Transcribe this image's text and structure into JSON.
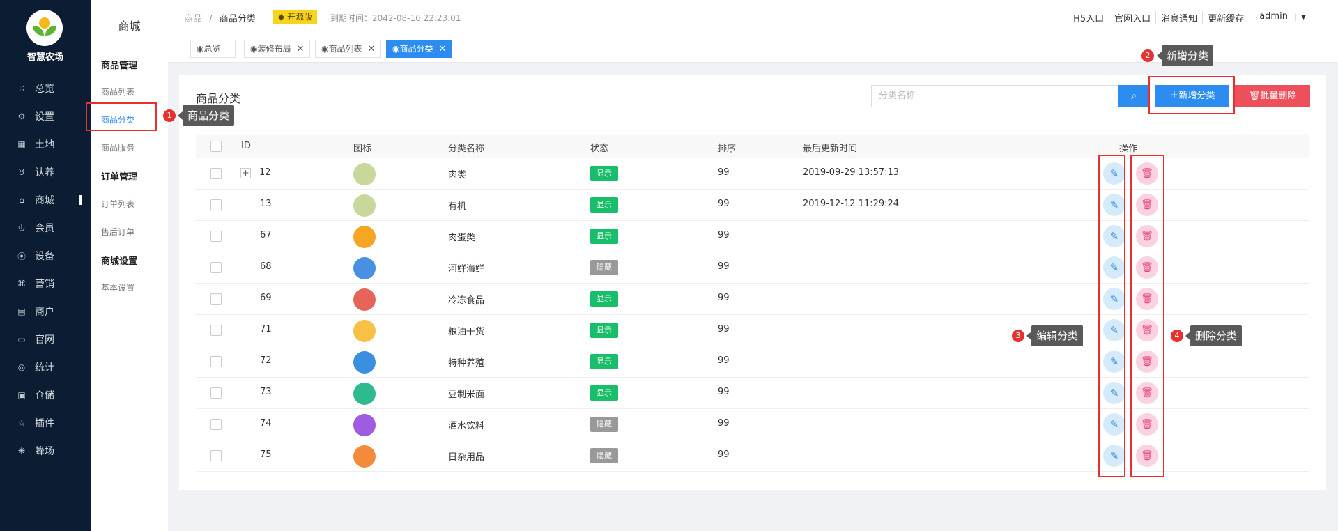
{
  "sidebar": {
    "brand": "智慧农场",
    "items": [
      {
        "icon": "grid-dots-icon",
        "glyph": "⁙",
        "label": "总览"
      },
      {
        "icon": "gear-icon",
        "glyph": "⚙",
        "label": "设置"
      },
      {
        "icon": "grid-icon",
        "glyph": "▦",
        "label": "土地"
      },
      {
        "icon": "bell-icon",
        "glyph": "♉",
        "label": "认养"
      },
      {
        "icon": "shop-icon",
        "glyph": "⌂",
        "label": "商城",
        "active": true
      },
      {
        "icon": "crown-icon",
        "glyph": "♔",
        "label": "会员"
      },
      {
        "icon": "pin-icon",
        "glyph": "⦿",
        "label": "设备"
      },
      {
        "icon": "share-icon",
        "glyph": "⌘",
        "label": "营销"
      },
      {
        "icon": "store-icon",
        "glyph": "▤",
        "label": "商户"
      },
      {
        "icon": "monitor-icon",
        "glyph": "▭",
        "label": "官网"
      },
      {
        "icon": "target-icon",
        "glyph": "◎",
        "label": "统计"
      },
      {
        "icon": "box-icon",
        "glyph": "▣",
        "label": "仓储"
      },
      {
        "icon": "star-icon",
        "glyph": "☆",
        "label": "插件"
      },
      {
        "icon": "bee-icon",
        "glyph": "❋",
        "label": "蜂场"
      }
    ]
  },
  "subnav": {
    "title": "商城",
    "group1": "商品管理",
    "item1": "商品列表",
    "item2": "商品分类",
    "item3": "商品服务",
    "group2": "订单管理",
    "item4": "订单列表",
    "item5": "售后订单",
    "group3": "商城设置",
    "item6": "基本设置"
  },
  "header": {
    "crumb1": "商品",
    "crumb_sep": "/",
    "crumb2": "商品分类",
    "badge": "开源版",
    "expire": "到期时间：2042-08-16 22:23:01",
    "links": [
      "H5入口",
      "官网入口",
      "消息通知",
      "更新缓存",
      "admin"
    ]
  },
  "tabs": [
    {
      "label": "◉总览"
    },
    {
      "label": "◉装修布局",
      "close": "✕"
    },
    {
      "label": "◉商品列表",
      "close": "✕"
    },
    {
      "label": "◉商品分类",
      "close": "✕",
      "active": true
    }
  ],
  "card": {
    "title": "商品分类",
    "search_placeholder": "分类名称",
    "add_label": "新增分类",
    "batch_delete_label": "批量删除"
  },
  "table": {
    "headers": {
      "id": "ID",
      "icon": "图标",
      "name": "分类名称",
      "status": "状态",
      "sort": "排序",
      "updated": "最后更新时间",
      "action": "操作"
    },
    "rows": [
      {
        "id": "12",
        "name": "肉类",
        "status": "显示",
        "sort": "99",
        "updated": "2019-09-29 13:57:13",
        "expand": "+",
        "color": "#c7d89a"
      },
      {
        "id": "13",
        "name": "有机",
        "status": "显示",
        "sort": "99",
        "updated": "2019-12-12 11:29:24",
        "color": "#c7d89a"
      },
      {
        "id": "67",
        "name": "肉蛋类",
        "status": "显示",
        "sort": "99",
        "updated": "",
        "color": "#f5a623"
      },
      {
        "id": "68",
        "name": "河鲜海鲜",
        "status": "隐藏",
        "sort": "99",
        "updated": "",
        "color": "#4a90e2"
      },
      {
        "id": "69",
        "name": "冷冻食品",
        "status": "显示",
        "sort": "99",
        "updated": "",
        "color": "#e8635a"
      },
      {
        "id": "71",
        "name": "粮油干货",
        "status": "显示",
        "sort": "99",
        "updated": "",
        "color": "#f8c146"
      },
      {
        "id": "72",
        "name": "特种养殖",
        "status": "显示",
        "sort": "99",
        "updated": "",
        "color": "#3a8fe0"
      },
      {
        "id": "73",
        "name": "豆制米面",
        "status": "显示",
        "sort": "99",
        "updated": "",
        "color": "#2fb98e"
      },
      {
        "id": "74",
        "name": "酒水饮料",
        "status": "隐藏",
        "sort": "99",
        "updated": "",
        "color": "#a05ce0"
      },
      {
        "id": "75",
        "name": "日杂用品",
        "status": "隐藏",
        "sort": "99",
        "updated": "",
        "color": "#f48a3c"
      }
    ]
  },
  "annotations": [
    {
      "num": "1",
      "text": "商品分类"
    },
    {
      "num": "2",
      "text": "新增分类"
    },
    {
      "num": "3",
      "text": "编辑分类"
    },
    {
      "num": "4",
      "text": "删除分类"
    }
  ],
  "colors": {
    "show": "#19be6b",
    "hide": "#999999",
    "primary": "#2d8cf0",
    "danger": "#ed4f5b",
    "sidebar_bg": "#0c1d33"
  }
}
